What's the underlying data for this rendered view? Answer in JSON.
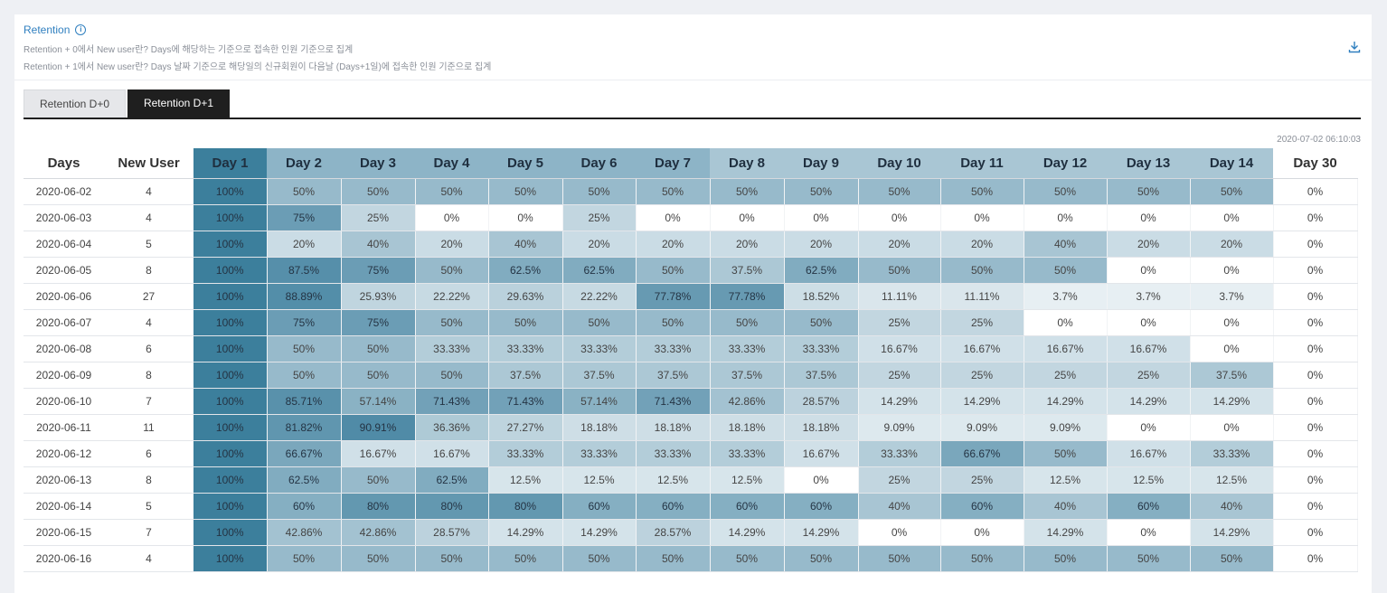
{
  "header": {
    "title": "Retention",
    "info_icon": "info-circle-icon",
    "desc1": "Retention + 0에서 New user란? Days에 해당하는 기준으로 접속한 인원 기준으로 집계",
    "desc2": "Retention + 1에서 New user란? Days 날짜 기준으로 해당일의 신규회원이 다음날 (Days+1일)에 접속한 인원 기준으로 집계",
    "download_icon": "download-icon"
  },
  "tabs": [
    {
      "label": "Retention D+0",
      "active": false
    },
    {
      "label": "Retention D+1",
      "active": true
    }
  ],
  "timestamp": "2020-07-02 06:10:03",
  "colors": {
    "accent": "#2f7fbf",
    "tab_active": "#1f1f1f",
    "day1_header": "#3c7f9c",
    "heat_high": "#4e8aa6",
    "heat_low": "#edf3f6"
  },
  "table": {
    "headers": [
      "Days",
      "New User",
      "Day 1",
      "Day 2",
      "Day 3",
      "Day 4",
      "Day 5",
      "Day 6",
      "Day 7",
      "Day 8",
      "Day 9",
      "Day 10",
      "Day 11",
      "Day 12",
      "Day 13",
      "Day 14",
      "Day 30"
    ],
    "rows": [
      {
        "date": "2020-06-02",
        "users": "4",
        "values": [
          "100%",
          "50%",
          "50%",
          "50%",
          "50%",
          "50%",
          "50%",
          "50%",
          "50%",
          "50%",
          "50%",
          "50%",
          "50%",
          "50%",
          "0%"
        ]
      },
      {
        "date": "2020-06-03",
        "users": "4",
        "values": [
          "100%",
          "75%",
          "25%",
          "0%",
          "0%",
          "25%",
          "0%",
          "0%",
          "0%",
          "0%",
          "0%",
          "0%",
          "0%",
          "0%",
          "0%"
        ]
      },
      {
        "date": "2020-06-04",
        "users": "5",
        "values": [
          "100%",
          "20%",
          "40%",
          "20%",
          "40%",
          "20%",
          "20%",
          "20%",
          "20%",
          "20%",
          "20%",
          "40%",
          "20%",
          "20%",
          "0%"
        ]
      },
      {
        "date": "2020-06-05",
        "users": "8",
        "values": [
          "100%",
          "87.5%",
          "75%",
          "50%",
          "62.5%",
          "62.5%",
          "50%",
          "37.5%",
          "62.5%",
          "50%",
          "50%",
          "50%",
          "0%",
          "0%",
          "0%"
        ]
      },
      {
        "date": "2020-06-06",
        "users": "27",
        "values": [
          "100%",
          "88.89%",
          "25.93%",
          "22.22%",
          "29.63%",
          "22.22%",
          "77.78%",
          "77.78%",
          "18.52%",
          "11.11%",
          "11.11%",
          "3.7%",
          "3.7%",
          "3.7%",
          "0%"
        ]
      },
      {
        "date": "2020-06-07",
        "users": "4",
        "values": [
          "100%",
          "75%",
          "75%",
          "50%",
          "50%",
          "50%",
          "50%",
          "50%",
          "50%",
          "25%",
          "25%",
          "0%",
          "0%",
          "0%",
          "0%"
        ]
      },
      {
        "date": "2020-06-08",
        "users": "6",
        "values": [
          "100%",
          "50%",
          "50%",
          "33.33%",
          "33.33%",
          "33.33%",
          "33.33%",
          "33.33%",
          "33.33%",
          "16.67%",
          "16.67%",
          "16.67%",
          "16.67%",
          "0%",
          "0%"
        ]
      },
      {
        "date": "2020-06-09",
        "users": "8",
        "values": [
          "100%",
          "50%",
          "50%",
          "50%",
          "37.5%",
          "37.5%",
          "37.5%",
          "37.5%",
          "37.5%",
          "25%",
          "25%",
          "25%",
          "25%",
          "37.5%",
          "0%"
        ]
      },
      {
        "date": "2020-06-10",
        "users": "7",
        "values": [
          "100%",
          "85.71%",
          "57.14%",
          "71.43%",
          "71.43%",
          "57.14%",
          "71.43%",
          "42.86%",
          "28.57%",
          "14.29%",
          "14.29%",
          "14.29%",
          "14.29%",
          "14.29%",
          "0%"
        ]
      },
      {
        "date": "2020-06-11",
        "users": "11",
        "values": [
          "100%",
          "81.82%",
          "90.91%",
          "36.36%",
          "27.27%",
          "18.18%",
          "18.18%",
          "18.18%",
          "18.18%",
          "9.09%",
          "9.09%",
          "9.09%",
          "0%",
          "0%",
          "0%"
        ]
      },
      {
        "date": "2020-06-12",
        "users": "6",
        "values": [
          "100%",
          "66.67%",
          "16.67%",
          "16.67%",
          "33.33%",
          "33.33%",
          "33.33%",
          "33.33%",
          "16.67%",
          "33.33%",
          "66.67%",
          "50%",
          "16.67%",
          "33.33%",
          "0%"
        ]
      },
      {
        "date": "2020-06-13",
        "users": "8",
        "values": [
          "100%",
          "62.5%",
          "50%",
          "62.5%",
          "12.5%",
          "12.5%",
          "12.5%",
          "12.5%",
          "0%",
          "25%",
          "25%",
          "12.5%",
          "12.5%",
          "12.5%",
          "0%"
        ]
      },
      {
        "date": "2020-06-14",
        "users": "5",
        "values": [
          "100%",
          "60%",
          "80%",
          "80%",
          "80%",
          "60%",
          "60%",
          "60%",
          "60%",
          "40%",
          "60%",
          "40%",
          "60%",
          "40%",
          "0%"
        ]
      },
      {
        "date": "2020-06-15",
        "users": "7",
        "values": [
          "100%",
          "42.86%",
          "42.86%",
          "28.57%",
          "14.29%",
          "14.29%",
          "28.57%",
          "14.29%",
          "14.29%",
          "0%",
          "0%",
          "14.29%",
          "0%",
          "14.29%",
          "0%"
        ]
      },
      {
        "date": "2020-06-16",
        "users": "4",
        "values": [
          "100%",
          "50%",
          "50%",
          "50%",
          "50%",
          "50%",
          "50%",
          "50%",
          "50%",
          "50%",
          "50%",
          "50%",
          "50%",
          "50%",
          "0%"
        ]
      }
    ]
  }
}
